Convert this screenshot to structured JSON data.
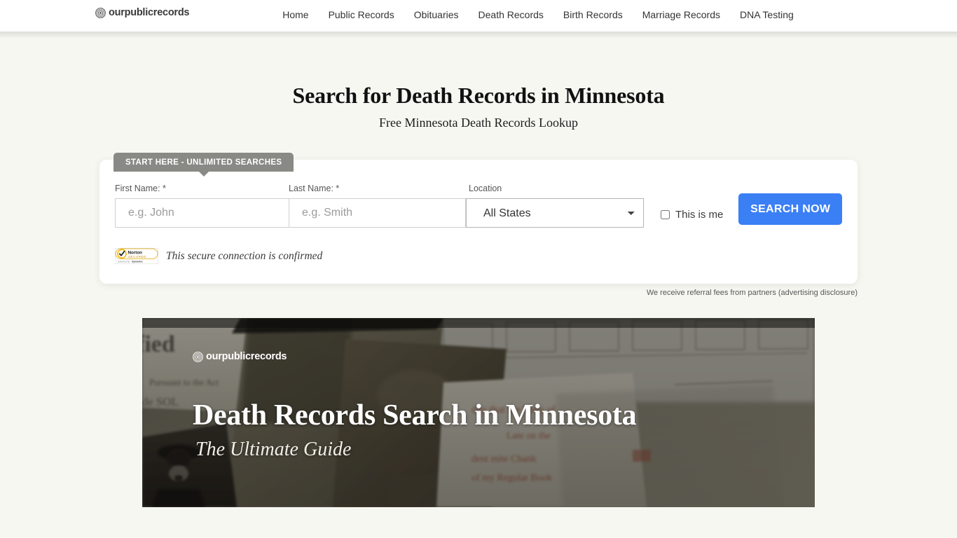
{
  "header": {
    "brand": {
      "icon": "fingerprint-icon",
      "text": "ourpublicrecords"
    },
    "nav": [
      {
        "label": "Home"
      },
      {
        "label": "Public Records"
      },
      {
        "label": "Obituaries"
      },
      {
        "label": "Death Records"
      },
      {
        "label": "Birth Records"
      },
      {
        "label": "Marriage Records"
      },
      {
        "label": "DNA Testing"
      }
    ]
  },
  "hero": {
    "title": "Search for Death Records in Minnesota",
    "subtitle": "Free Minnesota Death Records Lookup"
  },
  "search": {
    "badge": "START HERE - UNLIMITED SEARCHES",
    "first_name": {
      "label": "First Name: *",
      "placeholder": "e.g. John",
      "value": ""
    },
    "last_name": {
      "label": "Last Name: *",
      "placeholder": "e.g. Smith",
      "value": ""
    },
    "location": {
      "label": "Location",
      "selected": "All States",
      "options": [
        "All States"
      ]
    },
    "this_is_me": {
      "label": "This is me",
      "checked": false
    },
    "submit_label": "SEARCH NOW",
    "secure": {
      "badge_brand": "Norton",
      "badge_status": "SECURED",
      "badge_powered": "powered by Symantec",
      "text": "This secure connection is confirmed"
    },
    "accent_color": "#3b7ff5",
    "badge_color": "#898985"
  },
  "disclosure": "We receive referral fees from partners (advertising disclosure)",
  "banner": {
    "logo_text": "ourpublicrecords",
    "logo_icon": "fingerprint-icon",
    "title": "Death Records Search in Minnesota",
    "subtitle": "The Ultimate Guide"
  }
}
